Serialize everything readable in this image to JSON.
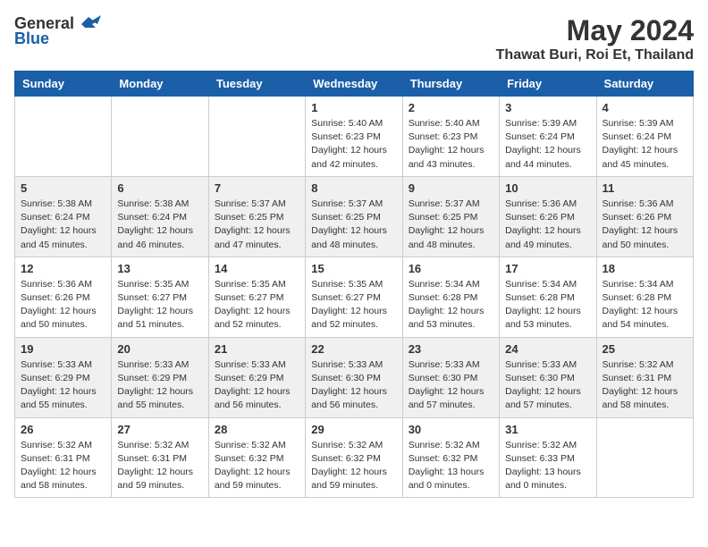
{
  "logo": {
    "general": "General",
    "blue": "Blue"
  },
  "title": "May 2024",
  "location": "Thawat Buri, Roi Et, Thailand",
  "days_header": [
    "Sunday",
    "Monday",
    "Tuesday",
    "Wednesday",
    "Thursday",
    "Friday",
    "Saturday"
  ],
  "weeks": [
    [
      {
        "day": "",
        "sunrise": "",
        "sunset": "",
        "daylight": ""
      },
      {
        "day": "",
        "sunrise": "",
        "sunset": "",
        "daylight": ""
      },
      {
        "day": "",
        "sunrise": "",
        "sunset": "",
        "daylight": ""
      },
      {
        "day": "1",
        "sunrise": "Sunrise: 5:40 AM",
        "sunset": "Sunset: 6:23 PM",
        "daylight": "Daylight: 12 hours and 42 minutes."
      },
      {
        "day": "2",
        "sunrise": "Sunrise: 5:40 AM",
        "sunset": "Sunset: 6:23 PM",
        "daylight": "Daylight: 12 hours and 43 minutes."
      },
      {
        "day": "3",
        "sunrise": "Sunrise: 5:39 AM",
        "sunset": "Sunset: 6:24 PM",
        "daylight": "Daylight: 12 hours and 44 minutes."
      },
      {
        "day": "4",
        "sunrise": "Sunrise: 5:39 AM",
        "sunset": "Sunset: 6:24 PM",
        "daylight": "Daylight: 12 hours and 45 minutes."
      }
    ],
    [
      {
        "day": "5",
        "sunrise": "Sunrise: 5:38 AM",
        "sunset": "Sunset: 6:24 PM",
        "daylight": "Daylight: 12 hours and 45 minutes."
      },
      {
        "day": "6",
        "sunrise": "Sunrise: 5:38 AM",
        "sunset": "Sunset: 6:24 PM",
        "daylight": "Daylight: 12 hours and 46 minutes."
      },
      {
        "day": "7",
        "sunrise": "Sunrise: 5:37 AM",
        "sunset": "Sunset: 6:25 PM",
        "daylight": "Daylight: 12 hours and 47 minutes."
      },
      {
        "day": "8",
        "sunrise": "Sunrise: 5:37 AM",
        "sunset": "Sunset: 6:25 PM",
        "daylight": "Daylight: 12 hours and 48 minutes."
      },
      {
        "day": "9",
        "sunrise": "Sunrise: 5:37 AM",
        "sunset": "Sunset: 6:25 PM",
        "daylight": "Daylight: 12 hours and 48 minutes."
      },
      {
        "day": "10",
        "sunrise": "Sunrise: 5:36 AM",
        "sunset": "Sunset: 6:26 PM",
        "daylight": "Daylight: 12 hours and 49 minutes."
      },
      {
        "day": "11",
        "sunrise": "Sunrise: 5:36 AM",
        "sunset": "Sunset: 6:26 PM",
        "daylight": "Daylight: 12 hours and 50 minutes."
      }
    ],
    [
      {
        "day": "12",
        "sunrise": "Sunrise: 5:36 AM",
        "sunset": "Sunset: 6:26 PM",
        "daylight": "Daylight: 12 hours and 50 minutes."
      },
      {
        "day": "13",
        "sunrise": "Sunrise: 5:35 AM",
        "sunset": "Sunset: 6:27 PM",
        "daylight": "Daylight: 12 hours and 51 minutes."
      },
      {
        "day": "14",
        "sunrise": "Sunrise: 5:35 AM",
        "sunset": "Sunset: 6:27 PM",
        "daylight": "Daylight: 12 hours and 52 minutes."
      },
      {
        "day": "15",
        "sunrise": "Sunrise: 5:35 AM",
        "sunset": "Sunset: 6:27 PM",
        "daylight": "Daylight: 12 hours and 52 minutes."
      },
      {
        "day": "16",
        "sunrise": "Sunrise: 5:34 AM",
        "sunset": "Sunset: 6:28 PM",
        "daylight": "Daylight: 12 hours and 53 minutes."
      },
      {
        "day": "17",
        "sunrise": "Sunrise: 5:34 AM",
        "sunset": "Sunset: 6:28 PM",
        "daylight": "Daylight: 12 hours and 53 minutes."
      },
      {
        "day": "18",
        "sunrise": "Sunrise: 5:34 AM",
        "sunset": "Sunset: 6:28 PM",
        "daylight": "Daylight: 12 hours and 54 minutes."
      }
    ],
    [
      {
        "day": "19",
        "sunrise": "Sunrise: 5:33 AM",
        "sunset": "Sunset: 6:29 PM",
        "daylight": "Daylight: 12 hours and 55 minutes."
      },
      {
        "day": "20",
        "sunrise": "Sunrise: 5:33 AM",
        "sunset": "Sunset: 6:29 PM",
        "daylight": "Daylight: 12 hours and 55 minutes."
      },
      {
        "day": "21",
        "sunrise": "Sunrise: 5:33 AM",
        "sunset": "Sunset: 6:29 PM",
        "daylight": "Daylight: 12 hours and 56 minutes."
      },
      {
        "day": "22",
        "sunrise": "Sunrise: 5:33 AM",
        "sunset": "Sunset: 6:30 PM",
        "daylight": "Daylight: 12 hours and 56 minutes."
      },
      {
        "day": "23",
        "sunrise": "Sunrise: 5:33 AM",
        "sunset": "Sunset: 6:30 PM",
        "daylight": "Daylight: 12 hours and 57 minutes."
      },
      {
        "day": "24",
        "sunrise": "Sunrise: 5:33 AM",
        "sunset": "Sunset: 6:30 PM",
        "daylight": "Daylight: 12 hours and 57 minutes."
      },
      {
        "day": "25",
        "sunrise": "Sunrise: 5:32 AM",
        "sunset": "Sunset: 6:31 PM",
        "daylight": "Daylight: 12 hours and 58 minutes."
      }
    ],
    [
      {
        "day": "26",
        "sunrise": "Sunrise: 5:32 AM",
        "sunset": "Sunset: 6:31 PM",
        "daylight": "Daylight: 12 hours and 58 minutes."
      },
      {
        "day": "27",
        "sunrise": "Sunrise: 5:32 AM",
        "sunset": "Sunset: 6:31 PM",
        "daylight": "Daylight: 12 hours and 59 minutes."
      },
      {
        "day": "28",
        "sunrise": "Sunrise: 5:32 AM",
        "sunset": "Sunset: 6:32 PM",
        "daylight": "Daylight: 12 hours and 59 minutes."
      },
      {
        "day": "29",
        "sunrise": "Sunrise: 5:32 AM",
        "sunset": "Sunset: 6:32 PM",
        "daylight": "Daylight: 12 hours and 59 minutes."
      },
      {
        "day": "30",
        "sunrise": "Sunrise: 5:32 AM",
        "sunset": "Sunset: 6:32 PM",
        "daylight": "Daylight: 13 hours and 0 minutes."
      },
      {
        "day": "31",
        "sunrise": "Sunrise: 5:32 AM",
        "sunset": "Sunset: 6:33 PM",
        "daylight": "Daylight: 13 hours and 0 minutes."
      },
      {
        "day": "",
        "sunrise": "",
        "sunset": "",
        "daylight": ""
      }
    ]
  ]
}
